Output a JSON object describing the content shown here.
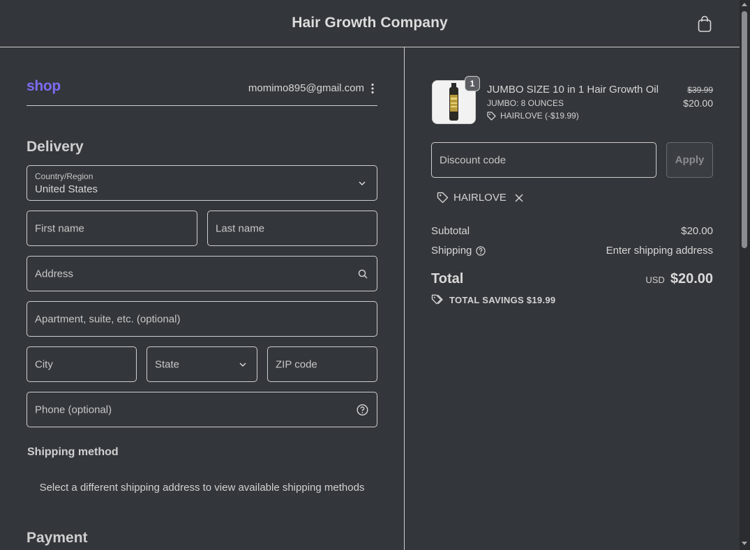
{
  "header": {
    "store_title": "Hair Growth Company"
  },
  "account": {
    "brand": "shop",
    "email": "momimo895@gmail.com"
  },
  "delivery": {
    "title": "Delivery",
    "country_label": "Country/Region",
    "country_value": "United States",
    "first_name_placeholder": "First name",
    "last_name_placeholder": "Last name",
    "address_placeholder": "Address",
    "apartment_placeholder": "Apartment, suite, etc. (optional)",
    "city_placeholder": "City",
    "state_placeholder": "State",
    "zip_placeholder": "ZIP code",
    "phone_placeholder": "Phone (optional)"
  },
  "shipping_method": {
    "title": "Shipping method",
    "note": "Select a different shipping address to view available shipping methods"
  },
  "payment": {
    "title": "Payment"
  },
  "order": {
    "item": {
      "quantity": "1",
      "name": "JUMBO SIZE 10 in 1 Hair Growth Oil",
      "variant": "JUMBO: 8 OUNCES",
      "discount": "HAIRLOVE (-$19.99)",
      "original_price": "$39.99",
      "price": "$20.00"
    },
    "discount_placeholder": "Discount code",
    "apply_label": "Apply",
    "applied_code": "HAIRLOVE",
    "subtotal_label": "Subtotal",
    "subtotal_value": "$20.00",
    "shipping_label": "Shipping",
    "shipping_value": "Enter shipping address",
    "total_label": "Total",
    "total_currency": "USD",
    "total_value": "$20.00",
    "savings_text": "TOTAL SAVINGS $19.99"
  }
}
